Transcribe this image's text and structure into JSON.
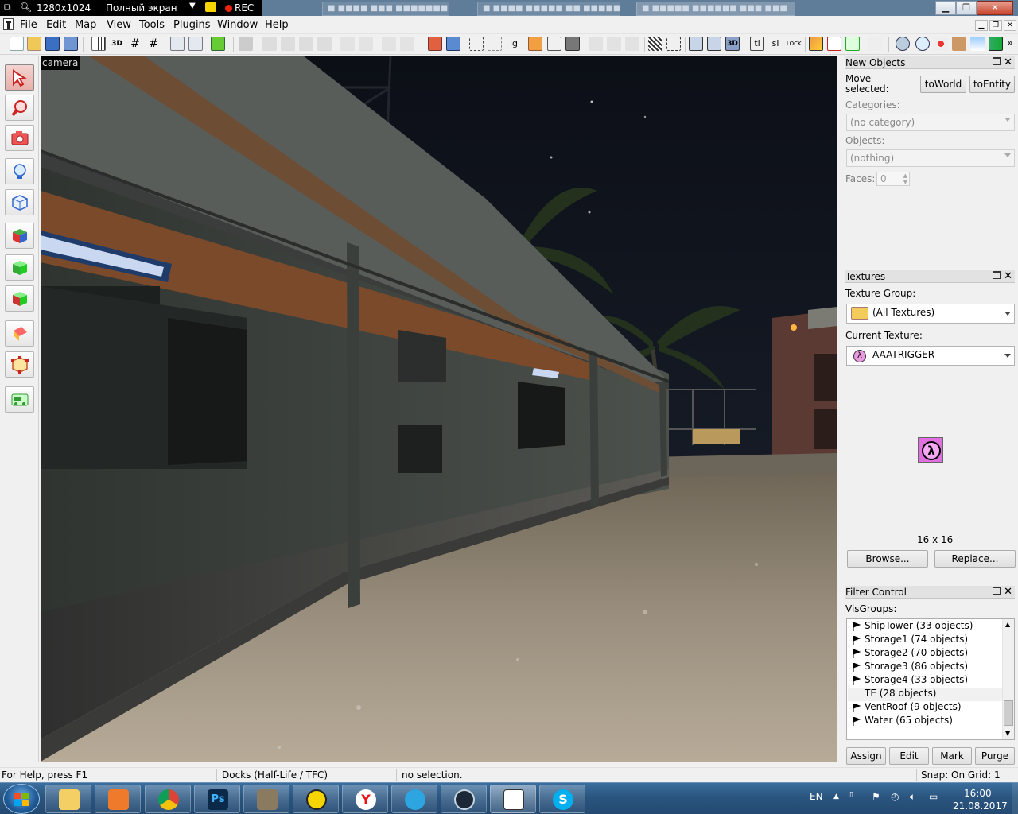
{
  "recorder": {
    "resolution": "1280x1024",
    "mode": "Полный экран",
    "rec_label": "REC"
  },
  "menu": [
    "File",
    "Edit",
    "Map",
    "View",
    "Tools",
    "Plugins",
    "Window",
    "Help"
  ],
  "viewport": {
    "label": "camera"
  },
  "new_objects": {
    "title": "New Objects",
    "move_selected": "Move selected:",
    "to_world": "toWorld",
    "to_entity": "toEntity",
    "categories_label": "Categories:",
    "categories_value": "(no category)",
    "objects_label": "Objects:",
    "objects_value": "(nothing)",
    "faces_label": "Faces:",
    "faces_value": "0"
  },
  "textures": {
    "title": "Textures",
    "group_label": "Texture Group:",
    "group_value": "(All Textures)",
    "current_label": "Current Texture:",
    "current_value": "AAATRIGGER",
    "size": "16 x 16",
    "browse": "Browse...",
    "replace": "Replace..."
  },
  "filter": {
    "title": "Filter Control",
    "visgroups_label": "VisGroups:",
    "items": [
      "ShipTower (33 objects)",
      "Storage1 (74 objects)",
      "Storage2 (70 objects)",
      "Storage3 (86 objects)",
      "Storage4 (33 objects)",
      "TE (28 objects)",
      "VentRoof (9 objects)",
      "Water (65 objects)"
    ],
    "selected_index": 5,
    "assign": "Assign",
    "edit": "Edit",
    "mark": "Mark",
    "purge": "Purge"
  },
  "status": {
    "help": "For Help, press F1",
    "map": "Docks (Half-Life / TFC)",
    "selection": "no selection.",
    "snap": "Snap: On Grid: 1"
  },
  "tray": {
    "lang": "EN",
    "time": "16:00",
    "date": "21.08.2017"
  },
  "colors": {
    "titlebar": "#5f7c99",
    "accent_active_tool": "#e8b0aa",
    "taskbar": "#2a557f"
  }
}
